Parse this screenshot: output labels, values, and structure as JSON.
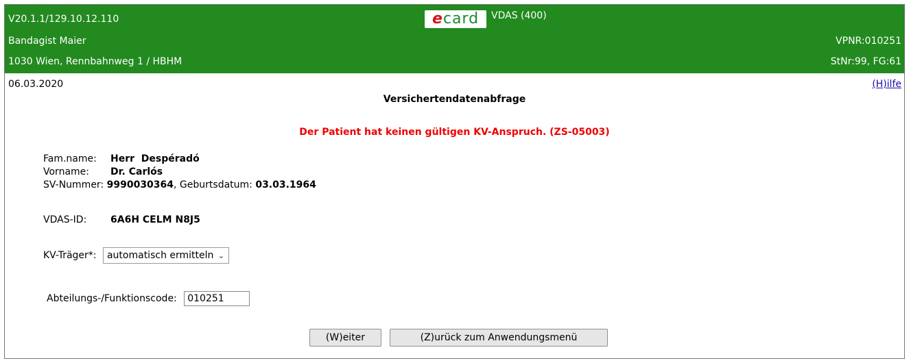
{
  "header": {
    "version": "V20.1.1/129.10.12.110",
    "logo_e": "e",
    "logo_card": "card",
    "title": "VDAS (400)",
    "provider_name": "Bandagist Maier",
    "vpnr": "VPNR:010251",
    "address": "1030 Wien, Rennbahnweg 1 / HBHM",
    "stnr": "StNr:99, FG:61",
    "bg_color": "#228a1f"
  },
  "date": "06.03.2020",
  "help_link": "(H)ilfe",
  "page_title": "Versichertendatenabfrage",
  "error_message": "Der Patient hat keinen gültigen KV-Anspruch. (ZS-05003)",
  "error_color": "#e00000",
  "patient": {
    "famname_label": "Fam.name:",
    "famname_value": "Herr  Despéradó",
    "vorname_label": "Vorname:",
    "vorname_value": "Dr. Carlós",
    "sv_label": "SV-Nummer:",
    "sv_value": "9990030364",
    "geb_label": ", Geburtsdatum:",
    "geb_value": "03.03.1964",
    "vdas_label": "VDAS-ID:",
    "vdas_value": "6A6H CELM N8J5"
  },
  "kv_traeger": {
    "label": "KV-Träger*:",
    "selected": "automatisch ermitteln"
  },
  "abteilung": {
    "label": "Abteilungs-/Funktionscode:",
    "value": "010251"
  },
  "buttons": {
    "weiter": "(W)eiter",
    "zurueck": "(Z)urück zum Anwendungsmenü"
  }
}
